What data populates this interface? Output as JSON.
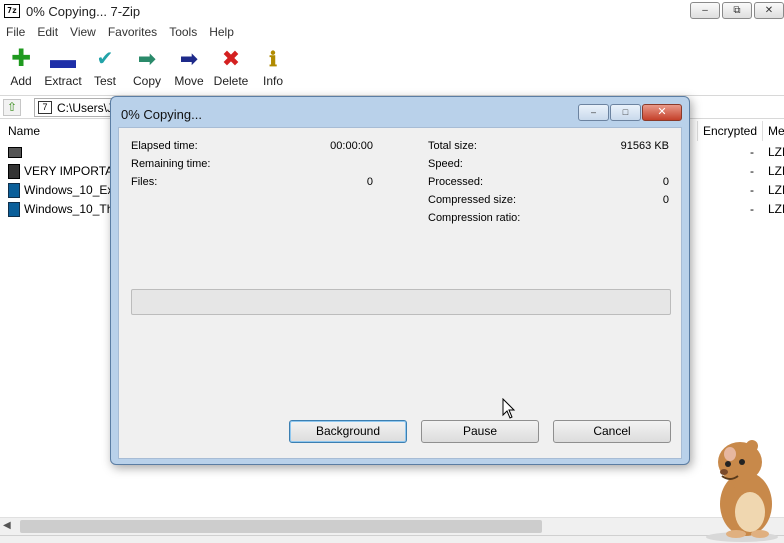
{
  "window": {
    "title": "0% Copying... 7-Zip",
    "app_icon": "7z",
    "controls": {
      "minimize": "–",
      "restore": "⧉",
      "close": "✕"
    }
  },
  "menu": [
    "File",
    "Edit",
    "View",
    "Favorites",
    "Tools",
    "Help"
  ],
  "toolbar": [
    {
      "label": "Add",
      "icon": "plus-icon",
      "color": "#1f9a1f"
    },
    {
      "label": "Extract",
      "icon": "minus-icon",
      "color": "#1e2fa8"
    },
    {
      "label": "Test",
      "icon": "check-icon",
      "color": "#22a3a8"
    },
    {
      "label": "Copy",
      "icon": "arrow-right-icon",
      "color": "#2a8a6a"
    },
    {
      "label": "Move",
      "icon": "arrow-right-icon",
      "color": "#1e2a8a"
    },
    {
      "label": "Delete",
      "icon": "x-icon",
      "color": "#d42020"
    },
    {
      "label": "Info",
      "icon": "info-icon",
      "color": "#b08a00"
    }
  ],
  "address": {
    "path": "C:\\Users\\J"
  },
  "filelist": {
    "columns": {
      "name": "Name",
      "encrypted": "Encrypted",
      "method": "Me"
    },
    "rows": [
      {
        "name": "",
        "encrypted": "-",
        "method": "LZM"
      },
      {
        "name": "VERY IMPORTAN",
        "encrypted": "-",
        "method": "LZM"
      },
      {
        "name": "Windows_10_Ext",
        "encrypted": "-",
        "method": "LZM"
      },
      {
        "name": "Windows_10_Th",
        "encrypted": "-",
        "method": "LZM"
      }
    ]
  },
  "dialog": {
    "title": "0% Copying...",
    "controls": {
      "minimize": "–",
      "maximize": "□",
      "close": "✕"
    },
    "left": [
      {
        "label": "Elapsed time:",
        "value": "00:00:00"
      },
      {
        "label": "Remaining time:",
        "value": ""
      },
      {
        "label": "Files:",
        "value": "0"
      }
    ],
    "right": [
      {
        "label": "Total size:",
        "value": "91563 KB"
      },
      {
        "label": "Speed:",
        "value": ""
      },
      {
        "label": "Processed:",
        "value": "0"
      },
      {
        "label": "Compressed size:",
        "value": "0"
      },
      {
        "label": "Compression ratio:",
        "value": ""
      }
    ],
    "progress_fraction": 0,
    "buttons": {
      "background": "Background",
      "pause": "Pause",
      "cancel": "Cancel"
    }
  }
}
